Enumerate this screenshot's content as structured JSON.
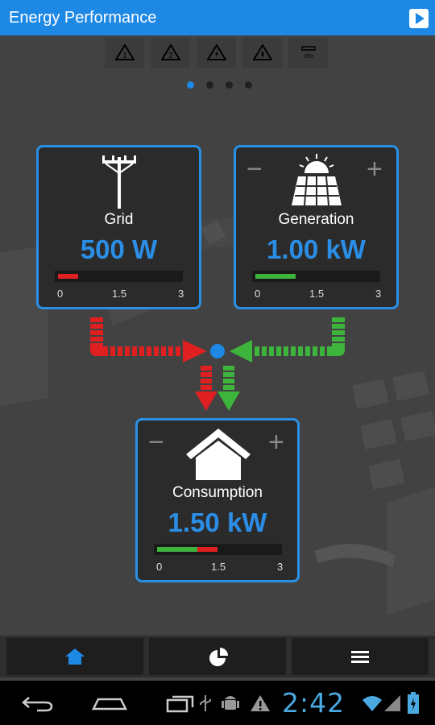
{
  "app": {
    "title": "Energy Performance"
  },
  "alerts": {
    "items": [
      {
        "icon": "warning-1-icon",
        "label": "1"
      },
      {
        "icon": "warning-2-icon",
        "label": "2"
      },
      {
        "icon": "warning-bolt-icon",
        "label": ""
      },
      {
        "icon": "warning-drop-icon",
        "label": ""
      },
      {
        "icon": "on-switch-icon",
        "label": "ON"
      }
    ]
  },
  "pager": {
    "count": 4,
    "active": 0
  },
  "grid": {
    "label": "Grid",
    "value": "500 W",
    "level_kw": 0.5,
    "scale_max": 3,
    "ticks": [
      "0",
      "1.5",
      "3"
    ],
    "bar_color": "#e02020"
  },
  "generation": {
    "label": "Generation",
    "value": "1.00 kW",
    "level_kw": 1.0,
    "scale_max": 3,
    "ticks": [
      "0",
      "1.5",
      "3"
    ],
    "bar_color": "#3db53d",
    "minus": "−",
    "plus": "+"
  },
  "consumption": {
    "label": "Consumption",
    "value": "1.50 kW",
    "green_kw": 1.0,
    "red_kw": 0.5,
    "scale_max": 3,
    "ticks": [
      "0",
      "1.5",
      "3"
    ],
    "minus": "−",
    "plus": "+"
  },
  "colors": {
    "accent": "#1e88e5",
    "grid_flow": "#e02020",
    "generation_flow": "#3db53d"
  },
  "nav": [
    {
      "icon": "home-icon",
      "active": true
    },
    {
      "icon": "pie-chart-icon",
      "active": false
    },
    {
      "icon": "menu-icon",
      "active": false
    }
  ],
  "system_bar": {
    "time": "2:42",
    "icons": [
      "back-icon",
      "home-outline-icon",
      "recent-apps-icon",
      "usb-icon",
      "android-debug-icon",
      "warning-icon",
      "wifi-icon",
      "signal-icon",
      "battery-charging-icon"
    ]
  }
}
